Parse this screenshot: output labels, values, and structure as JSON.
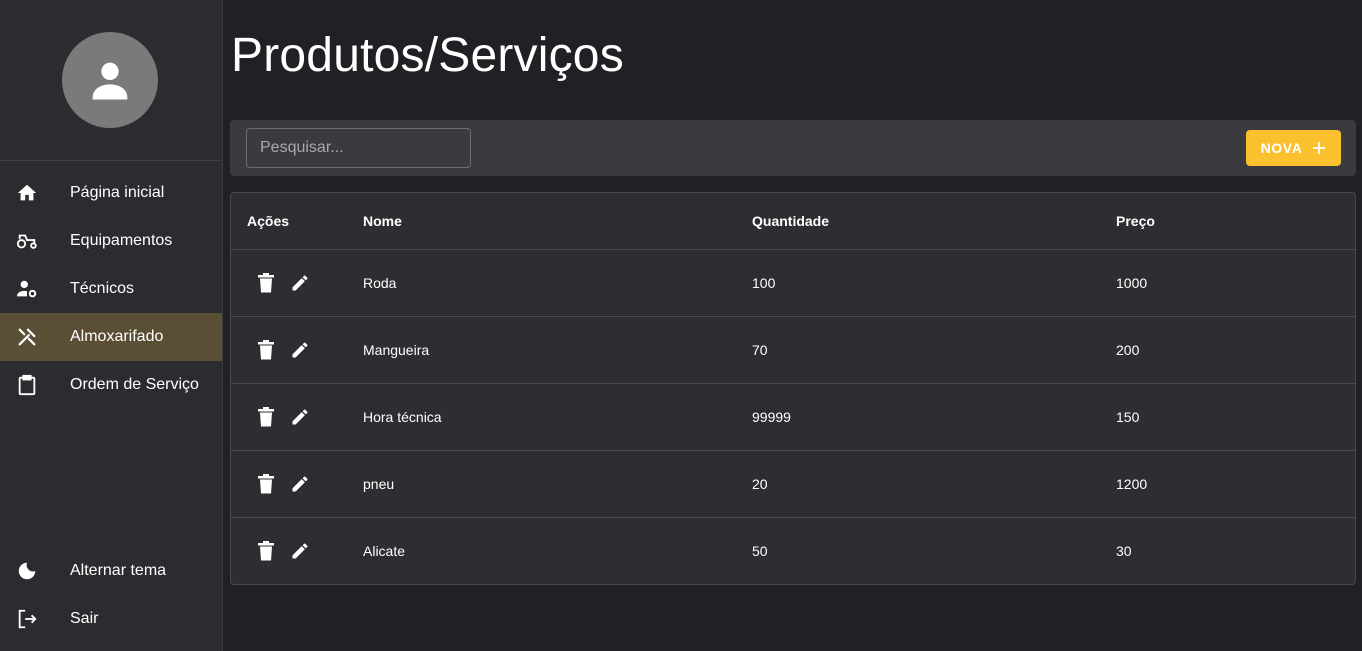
{
  "sidebar": {
    "nav_items": [
      {
        "label": "Página inicial",
        "icon": "home-icon"
      },
      {
        "label": "Equipamentos",
        "icon": "tractor-icon"
      },
      {
        "label": "Técnicos",
        "icon": "user-gear-icon"
      },
      {
        "label": "Almoxarifado",
        "icon": "tools-icon",
        "active": true
      },
      {
        "label": "Ordem de Serviço",
        "icon": "clipboard-icon"
      }
    ],
    "bottom_items": [
      {
        "label": "Alternar tema",
        "icon": "moon-icon"
      },
      {
        "label": "Sair",
        "icon": "logout-icon"
      }
    ]
  },
  "page": {
    "title": "Produtos/Serviços"
  },
  "toolbar": {
    "search_placeholder": "Pesquisar...",
    "new_button_label": "NOVA"
  },
  "table": {
    "headers": {
      "actions": "Ações",
      "name": "Nome",
      "quantity": "Quantidade",
      "price": "Preço"
    },
    "rows": [
      {
        "name": "Roda",
        "quantity": "100",
        "price": "1000"
      },
      {
        "name": "Mangueira",
        "quantity": "70",
        "price": "200"
      },
      {
        "name": "Hora técnica",
        "quantity": "99999",
        "price": "150"
      },
      {
        "name": "pneu",
        "quantity": "20",
        "price": "1200"
      },
      {
        "name": "Alicate",
        "quantity": "50",
        "price": "30"
      }
    ]
  },
  "colors": {
    "accent": "#fbc02d",
    "active_nav_bg": "#5a4e35",
    "background": "#202124",
    "sidebar_bg": "#2b2c2f"
  }
}
